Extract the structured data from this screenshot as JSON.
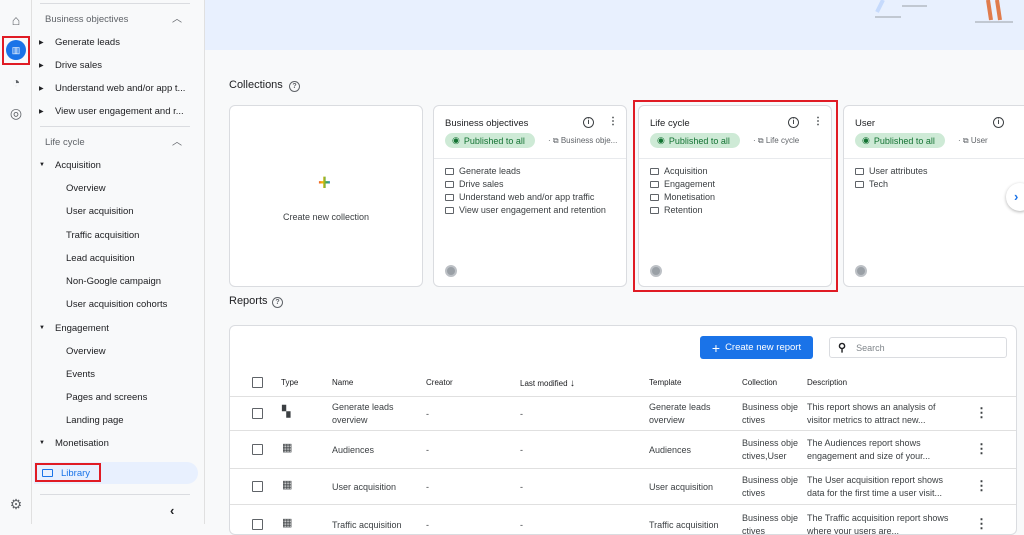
{
  "rail": {
    "icons": [
      "home-icon",
      "reports-icon",
      "explore-icon",
      "advertising-icon",
      "settings-icon"
    ]
  },
  "sidebar": {
    "business_objectives": {
      "title": "Business objectives",
      "items": [
        "Generate leads",
        "Drive sales",
        "Understand web and/or app t...",
        "View user engagement and r..."
      ]
    },
    "life_cycle": {
      "title": "Life cycle",
      "acquisition": {
        "label": "Acquisition",
        "items": [
          "Overview",
          "User acquisition",
          "Traffic acquisition",
          "Lead acquisition",
          "Non-Google campaign",
          "User acquisition cohorts"
        ]
      },
      "engagement": {
        "label": "Engagement",
        "items": [
          "Overview",
          "Events",
          "Pages and screens",
          "Landing page"
        ]
      },
      "monetisation": {
        "label": "Monetisation"
      }
    },
    "library": "Library"
  },
  "collections": {
    "title": "Collections",
    "create_label": "Create new collection",
    "cards": [
      {
        "title": "Business objectives",
        "status": "Published to all",
        "template": "Business obje...",
        "folders": [
          "Generate leads",
          "Drive sales",
          "Understand web and/or app traffic",
          "View user engagement and retention"
        ]
      },
      {
        "title": "Life cycle",
        "status": "Published to all",
        "template": "Life cycle",
        "folders": [
          "Acquisition",
          "Engagement",
          "Monetisation",
          "Retention"
        ]
      },
      {
        "title": "User",
        "status": "Published to all",
        "template": "User",
        "folders": [
          "User attributes",
          "Tech"
        ]
      }
    ]
  },
  "reports": {
    "title": "Reports",
    "create_label": "Create new report",
    "search_placeholder": "Search",
    "columns": [
      "Type",
      "Name",
      "Creator",
      "Last modified",
      "Template",
      "Collection",
      "Description"
    ],
    "rows": [
      {
        "type": "overview",
        "name": "Generate leads overview",
        "creator": "-",
        "modified": "-",
        "template": "Generate leads overview",
        "collection": "Business objectives",
        "description": "This report shows an analysis of visitor metrics to attract new..."
      },
      {
        "type": "detail",
        "name": "Audiences",
        "creator": "-",
        "modified": "-",
        "template": "Audiences",
        "collection": "Business objectives,User",
        "description": "The Audiences report shows engagement and size of your..."
      },
      {
        "type": "detail",
        "name": "User acquisition",
        "creator": "-",
        "modified": "-",
        "template": "User acquisition",
        "collection": "Business objectives",
        "description": "The User acquisition report shows data for the first time a user visit..."
      },
      {
        "type": "detail",
        "name": "Traffic acquisition",
        "creator": "-",
        "modified": "-",
        "template": "Traffic acquisition",
        "collection": "Business objectives",
        "description": "The Traffic acquisition report shows where your users are..."
      }
    ]
  },
  "colors": {
    "accent": "#1a73e8",
    "highlight": "#e01b24",
    "published": "#137333"
  }
}
